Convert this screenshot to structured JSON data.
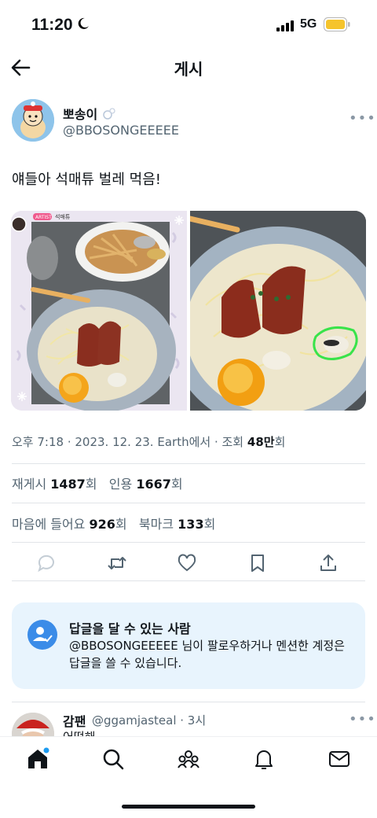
{
  "status": {
    "time": "11:20",
    "network": "5G"
  },
  "header": {
    "title": "게시"
  },
  "tweet": {
    "author_name": "뽀송이",
    "author_handle": "@BBOSONGEEEEE",
    "text": "얘들아 석매튜 벌레 먹음!",
    "image_label_badge": "ARTIST",
    "image_label_name": "석매튜",
    "meta": {
      "time": "오후 7:18",
      "date": "2023. 12. 23.",
      "source": "Earth에서",
      "views_label": "조회",
      "views": "48만",
      "views_unit": "회"
    },
    "stats": {
      "retweets_label": "재게시",
      "retweets": "1487",
      "quotes_label": "인용",
      "quotes": "1667",
      "unit": "회",
      "likes_label": "마음에 들어요",
      "likes": "926",
      "bookmarks_label": "북마크",
      "bookmarks": "133"
    }
  },
  "reply_card": {
    "title": "답글을 달 수 있는 사람",
    "body": "@BBOSONGEEEEE 님이 팔로우하거나 멘션한 계정은 답글을 쓸 수 있습니다."
  },
  "reply": {
    "name": "감팬",
    "handle_time": "@ggamjasteal · 3시",
    "text": "어떡해"
  },
  "colors": {
    "accent": "#1d9bf0",
    "card_bg": "#e8f4fd",
    "green_circle": "#39e34a"
  },
  "icons": [
    "back-arrow-icon",
    "more-icon",
    "reply-icon",
    "retweet-icon",
    "like-icon",
    "bookmark-icon",
    "share-icon",
    "people-icon",
    "home-icon",
    "search-icon",
    "communities-icon",
    "notifications-icon",
    "messages-icon"
  ]
}
